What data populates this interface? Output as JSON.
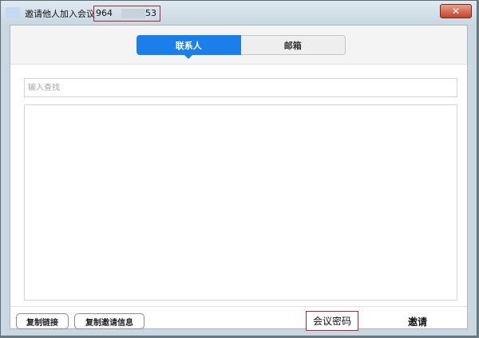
{
  "window": {
    "title": "邀请他人加入会议",
    "meeting_id_start": "964",
    "meeting_id_end": "53",
    "close_symbol": "✕"
  },
  "tabs": [
    {
      "label": "联系人",
      "active": true
    },
    {
      "label": "邮箱",
      "active": false
    }
  ],
  "search": {
    "placeholder": "输入查找",
    "value": ""
  },
  "footer": {
    "copy_link_label": "复制链接",
    "copy_invite_label": "复制邀请信息",
    "password_label": "会议密码",
    "invite_label": "邀请"
  },
  "colors": {
    "accent": "#1a7fea",
    "highlight_border": "#b3262b",
    "close_button": "#c4432b"
  },
  "icons": {
    "app": "app-icon",
    "close": "close-icon"
  }
}
